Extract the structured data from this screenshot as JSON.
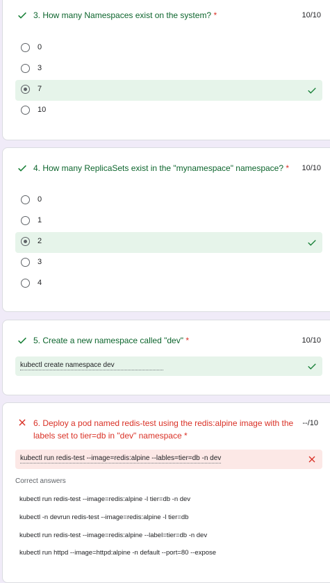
{
  "questions": [
    {
      "title": "3. How many Namespaces exist on the system?",
      "required_mark": "*",
      "score": "10/10",
      "status_icon": "check-icon",
      "options": [
        "0",
        "3",
        "7",
        "10"
      ],
      "selected_index": 2
    },
    {
      "title": "4. How many ReplicaSets exist in the \"mynamespace\" namespace?",
      "required_mark": "*",
      "score": "10/10",
      "status_icon": "check-icon",
      "options": [
        "0",
        "1",
        "2",
        "3",
        "4"
      ],
      "selected_index": 2
    },
    {
      "title": "5. Create a new namespace called \"dev\"",
      "required_mark": "*",
      "score": "10/10",
      "status_icon": "check-icon",
      "answer": "kubectl create namespace dev"
    },
    {
      "title": "6. Deploy a pod named redis-test using the redis:alpine image with the labels set to tier=db in \"dev\" namespace",
      "required_mark": "*",
      "score": "--/10",
      "status_icon": "close-icon",
      "answer": "kubectl run redis-test --image=redis:alpine --lables=tier=db -n dev",
      "correct_answers_heading": "Correct answers",
      "correct_answers": [
        "kubectl run redis-test --image=redis:alpine -l tier=db -n dev",
        "kubectl -n devrun redis-test --image=redis:alpine -l tier=db",
        "kubectl run redis-test --image=redis:alpine --label=tier=db -n dev",
        "kubectl run httpd --image=httpd:alpine -n default --port=80 --expose"
      ]
    }
  ],
  "colors": {
    "correct_green": "#188038",
    "correct_bg": "#e6f4ea",
    "wrong_red": "#d93025",
    "wrong_bg": "#fce8e6",
    "page_bg": "#f0ebf8"
  }
}
